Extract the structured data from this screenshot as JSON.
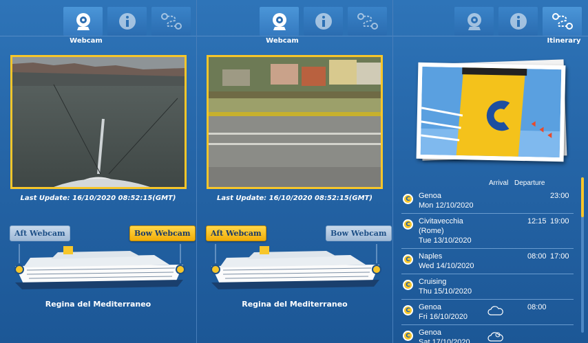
{
  "panels": [
    {
      "tab_label": "Webcam",
      "last_update": "Last Update: 16/10/2020 08:52:15(GMT)",
      "aft_label": "Aft Webcam",
      "bow_label": "Bow Webcam",
      "ship_name": "Regina del Mediterraneo",
      "active_cam": "bow"
    },
    {
      "tab_label": "Webcam",
      "last_update": "Last Update: 16/10/2020 08:52:15(GMT)",
      "aft_label": "Aft Webcam",
      "bow_label": "Bow Webcam",
      "ship_name": "Regina del Mediterraneo",
      "active_cam": "aft"
    }
  ],
  "itinerary": {
    "tab_label": "Itinerary",
    "col_arrival": "Arrival",
    "col_departure": "Departure",
    "stops": [
      {
        "port": "Genoa",
        "port2": "",
        "date": "Mon 12/10/2020",
        "arrival": "",
        "departure": "23:00",
        "weather": ""
      },
      {
        "port": "Civitavecchia",
        "port2": "(Rome)",
        "date": "Tue 13/10/2020",
        "arrival": "12:15",
        "departure": "19:00",
        "weather": ""
      },
      {
        "port": "Naples",
        "port2": "",
        "date": "Wed 14/10/2020",
        "arrival": "08:00",
        "departure": "17:00",
        "weather": ""
      },
      {
        "port": "Cruising",
        "port2": "",
        "date": "Thu 15/10/2020",
        "arrival": "",
        "departure": "",
        "weather": ""
      },
      {
        "port": "Genoa",
        "port2": "",
        "date": "Fri 16/10/2020",
        "arrival": "08:00",
        "departure": "",
        "weather": "cloud-icon"
      },
      {
        "port": "Genoa",
        "port2": "",
        "date": "Sat 17/10/2020",
        "arrival": "",
        "departure": "",
        "weather": "sun-cloud-icon"
      }
    ]
  },
  "icons": {
    "webcam": "webcam-icon",
    "info": "info-icon",
    "itinerary": "route-icon",
    "logo": "costa-c-icon"
  },
  "colors": {
    "accent": "#f7c62a",
    "panel": "#2565a7"
  }
}
